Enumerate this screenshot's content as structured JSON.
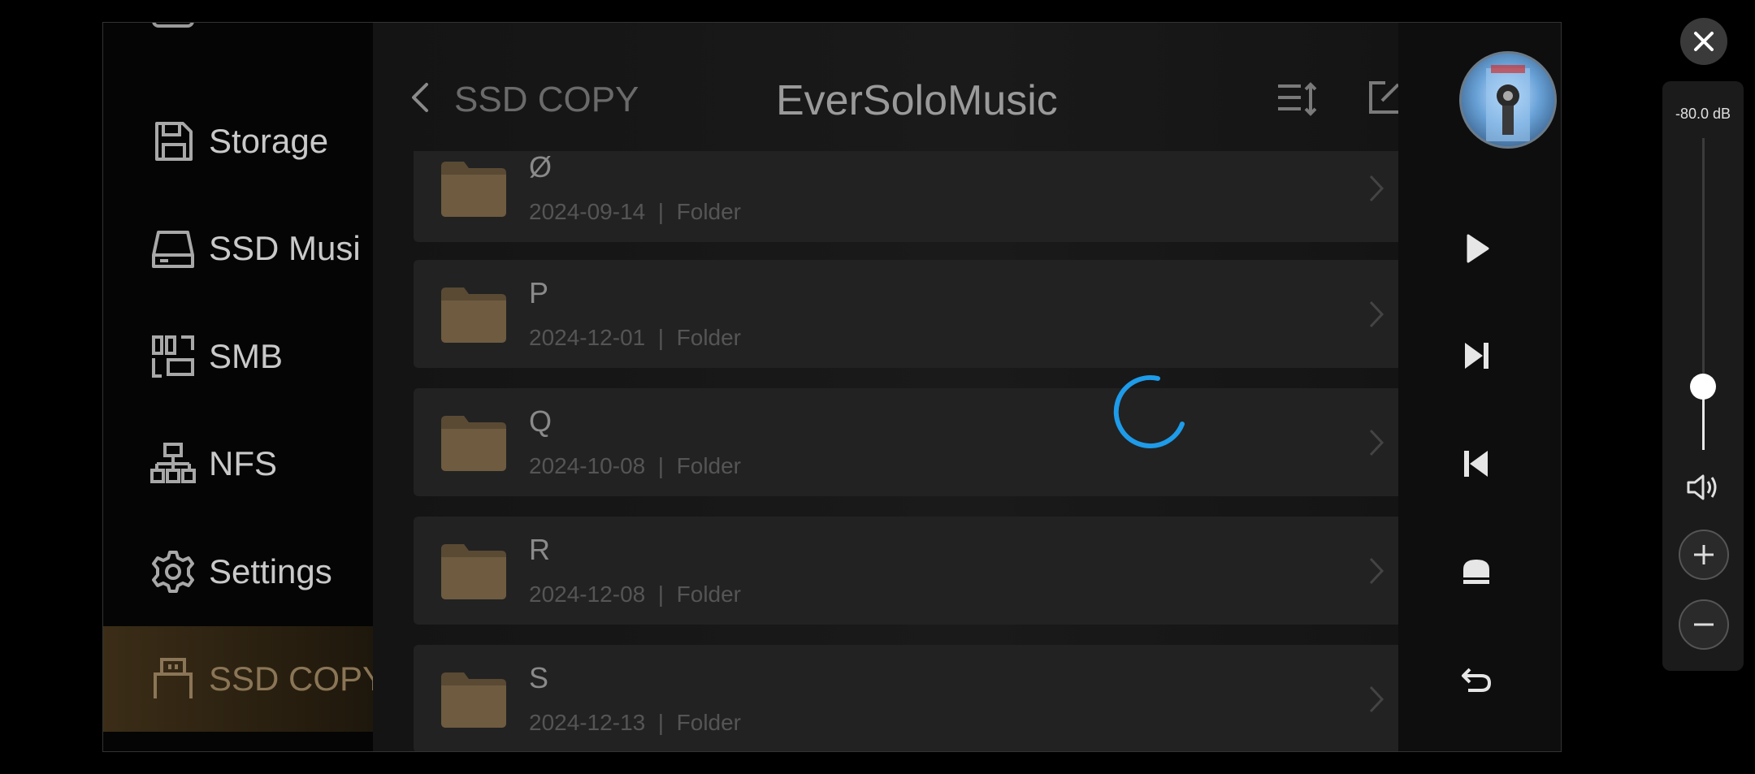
{
  "sidebar": {
    "items": [
      {
        "label": "Storage",
        "icon": "floppy-disk-icon"
      },
      {
        "label": "SSD Musi",
        "icon": "hard-drive-icon"
      },
      {
        "label": "SMB",
        "icon": "network-share-icon"
      },
      {
        "label": "NFS",
        "icon": "network-tree-icon"
      },
      {
        "label": "Settings",
        "icon": "gear-icon"
      },
      {
        "label": "SSD COPY",
        "icon": "usb-icon",
        "active": true
      }
    ]
  },
  "header": {
    "back_label": "SSD COPY",
    "title": "EverSoloMusic"
  },
  "folders": [
    {
      "name": "Ø",
      "date": "2024-09-14",
      "type": "Folder"
    },
    {
      "name": "P",
      "date": "2024-12-01",
      "type": "Folder"
    },
    {
      "name": "Q",
      "date": "2024-10-08",
      "type": "Folder"
    },
    {
      "name": "R",
      "date": "2024-12-08",
      "type": "Folder"
    },
    {
      "name": "S",
      "date": "2024-12-13",
      "type": "Folder"
    }
  ],
  "separator": "|",
  "volume": {
    "db_label": "-80.0 dB",
    "level_fraction": 0.2
  },
  "colors": {
    "accent_spinner": "#1e9be9",
    "active_bg": "#3b2d17"
  }
}
